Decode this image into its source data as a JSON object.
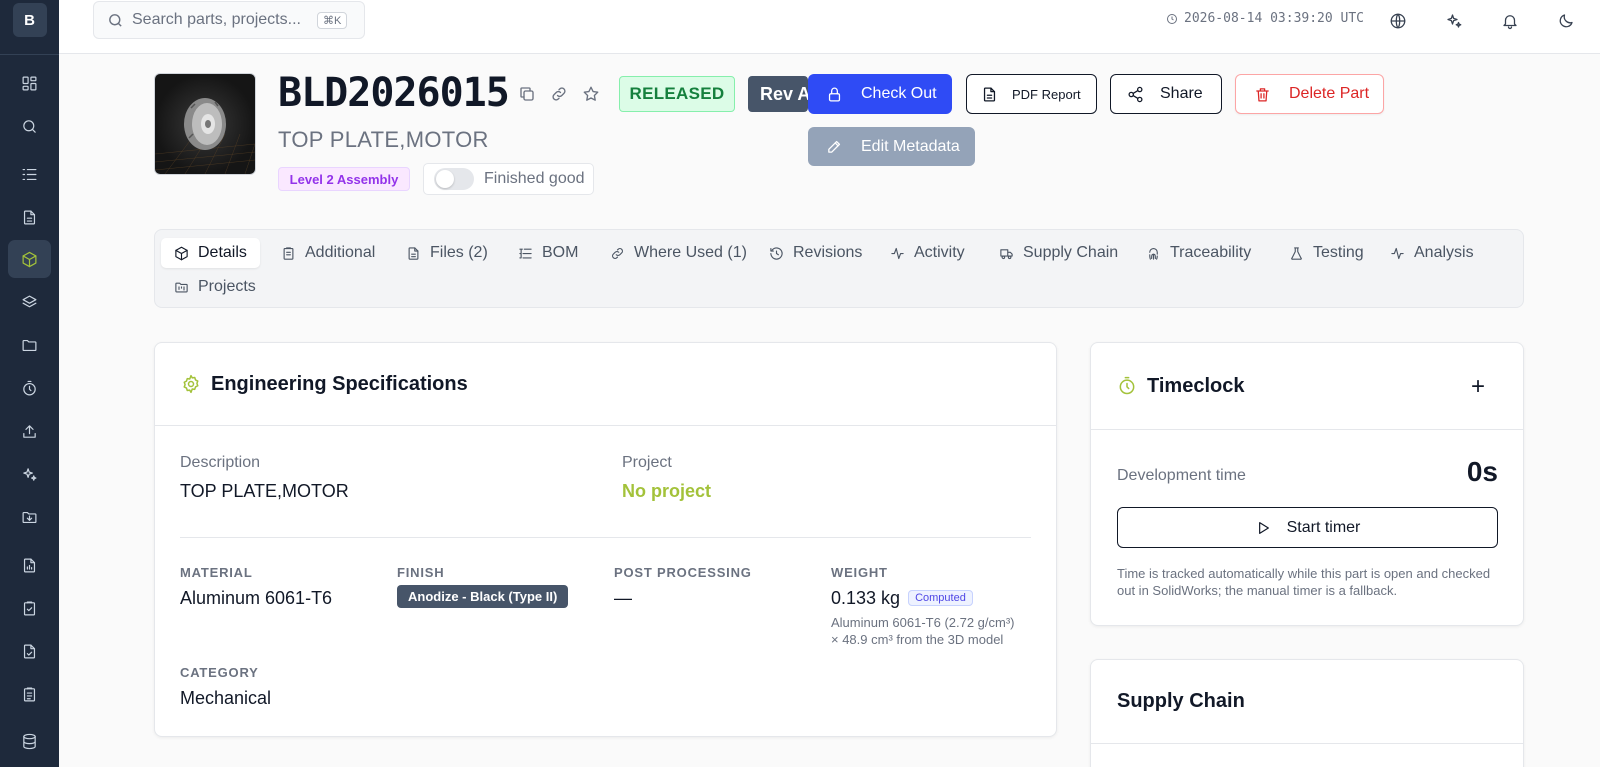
{
  "app": {
    "brand_letter": "B"
  },
  "sidebar": {
    "items": [
      {
        "name": "dashboard-icon"
      },
      {
        "name": "search-icon"
      },
      {
        "name": "list-icon"
      },
      {
        "name": "document-icon"
      },
      {
        "name": "cube-icon",
        "active": true
      },
      {
        "name": "layers-icon"
      },
      {
        "name": "folder-icon"
      },
      {
        "name": "timer-icon"
      },
      {
        "name": "upload-icon"
      },
      {
        "name": "sparkles-icon"
      },
      {
        "name": "folder-download-icon"
      },
      {
        "name": "file-chart-icon"
      },
      {
        "name": "clipboard-check-icon"
      },
      {
        "name": "file-check-icon"
      },
      {
        "name": "clipboard-list-icon"
      },
      {
        "name": "database-icon"
      }
    ]
  },
  "topbar": {
    "search_placeholder": "Search parts, projects...",
    "search_shortcut": "⌘K",
    "timestamp": "2026-08-14 03:39:20 UTC"
  },
  "part": {
    "number": "BLD2026015",
    "description": "TOP PLATE,MOTOR",
    "status": "RELEASED",
    "revision": "Rev A",
    "level": "Level 2 Assembly",
    "finished_good_label": "Finished good",
    "finished_good": false
  },
  "actions": {
    "check_out": "Check Out",
    "edit_metadata": "Edit Metadata",
    "pdf_report": "PDF Report",
    "share": "Share",
    "delete": "Delete Part"
  },
  "tabs": [
    {
      "label": "Details",
      "active": true
    },
    {
      "label": "Additional"
    },
    {
      "label": "Files (2)"
    },
    {
      "label": "BOM"
    },
    {
      "label": "Where Used (1)"
    },
    {
      "label": "Revisions"
    },
    {
      "label": "Activity"
    },
    {
      "label": "Supply Chain"
    },
    {
      "label": "Traceability"
    },
    {
      "label": "Testing"
    },
    {
      "label": "Analysis"
    },
    {
      "label": "Projects"
    }
  ],
  "eng_specs": {
    "title": "Engineering Specifications",
    "description_label": "Description",
    "description_value": "TOP PLATE,MOTOR",
    "project_label": "Project",
    "project_value": "No project",
    "material_label": "MATERIAL",
    "material_value": "Aluminum 6061-T6",
    "finish_label": "FINISH",
    "finish_value": "Anodize - Black (Type II)",
    "post_processing_label": "POST PROCESSING",
    "post_processing_value": "—",
    "weight_label": "WEIGHT",
    "weight_value": "0.133 kg",
    "weight_badge": "Computed",
    "weight_note_1": "Aluminum 6061-T6 (2.72 g/cm³)",
    "weight_note_2": "× 48.9 cm³ from the 3D model",
    "category_label": "CATEGORY",
    "category_value": "Mechanical"
  },
  "timeclock": {
    "title": "Timeclock",
    "add_label": "+",
    "dev_time_label": "Development time",
    "dev_time_value": "0s",
    "start_label": "Start timer",
    "note": "Time is tracked automatically while this part is open and checked out in SolidWorks; the manual timer is a fallback."
  },
  "supply_chain": {
    "title": "Supply Chain"
  },
  "colors": {
    "sidebar_bg": "#1e293b",
    "accent_green": "#a3c23a",
    "primary_blue": "#2f4bf5",
    "danger_red": "#dc2626",
    "released_green": "#15803d"
  }
}
